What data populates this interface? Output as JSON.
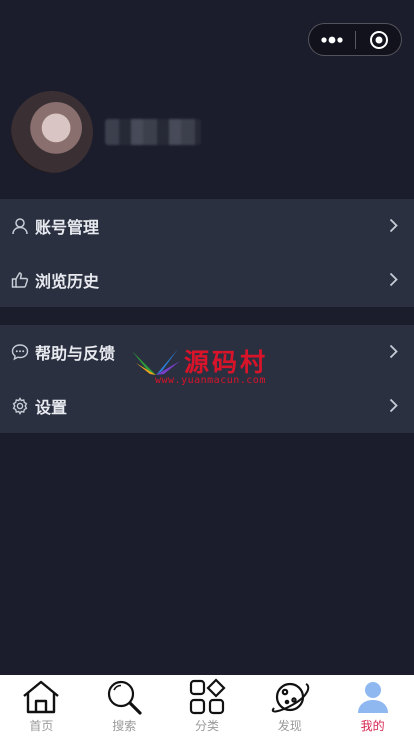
{
  "capsule": {
    "more_icon": "more-dots-icon",
    "close_icon": "target-close-icon"
  },
  "profile": {
    "username": ""
  },
  "menu": {
    "group1": [
      {
        "label": "账号管理",
        "icon": "user-icon"
      },
      {
        "label": "浏览历史",
        "icon": "thumbs-up-icon"
      }
    ],
    "group2": [
      {
        "label": "帮助与反馈",
        "icon": "chat-bubble-icon"
      },
      {
        "label": "设置",
        "icon": "gear-icon"
      }
    ]
  },
  "watermark": {
    "text": "源码村",
    "url": "www.yuanmacun.com"
  },
  "tabbar": [
    {
      "label": "首页",
      "icon": "home-icon"
    },
    {
      "label": "搜索",
      "icon": "search-icon"
    },
    {
      "label": "分类",
      "icon": "category-icon"
    },
    {
      "label": "发现",
      "icon": "planet-icon"
    },
    {
      "label": "我的",
      "icon": "profile-icon",
      "active": true
    }
  ],
  "colors": {
    "background": "#1b1d2c",
    "menu_bg": "#2a3040",
    "active_tab": "#d7264f",
    "active_icon": "#8fb7f0"
  }
}
